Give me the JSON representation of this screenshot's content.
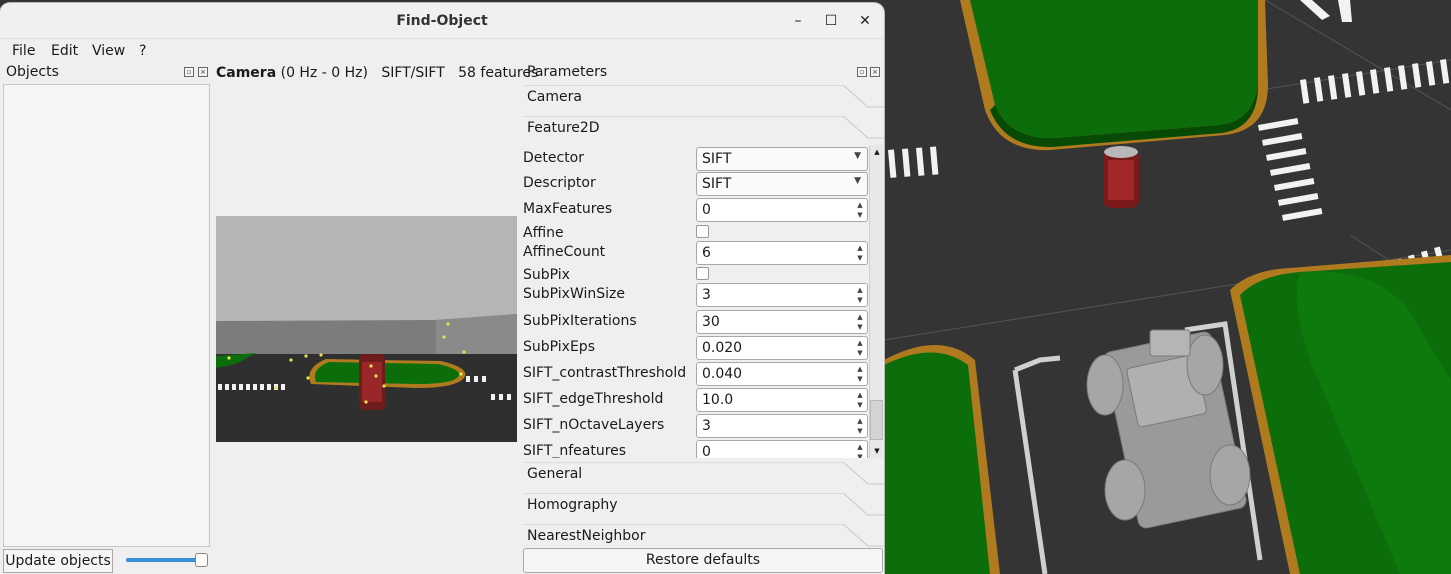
{
  "window": {
    "title": "Find-Object",
    "minimize_glyph": "–",
    "maximize_glyph": "☐",
    "close_glyph": "✕"
  },
  "menu": [
    "File",
    "Edit",
    "View",
    "?"
  ],
  "objects_dock": {
    "title": "Objects",
    "update_label": "Update objects",
    "slider_level": 1.0
  },
  "camera": {
    "name": "Camera",
    "rate": "(0 Hz - 0 Hz)",
    "algo": "SIFT/SIFT",
    "features": "58 features"
  },
  "parameters": {
    "title": "Parameters",
    "tabs_top": [
      "Camera",
      "Feature2D"
    ],
    "rows": [
      {
        "label": "Detector",
        "kind": "combo",
        "value": "SIFT"
      },
      {
        "label": "Descriptor",
        "kind": "combo",
        "value": "SIFT"
      },
      {
        "label": "MaxFeatures",
        "kind": "spin",
        "value": "0"
      },
      {
        "label": "Affine",
        "kind": "check",
        "value": ""
      },
      {
        "label": "AffineCount",
        "kind": "spin",
        "value": "6"
      },
      {
        "label": "SubPix",
        "kind": "check",
        "value": ""
      },
      {
        "label": "SubPixWinSize",
        "kind": "spin",
        "value": "3"
      },
      {
        "label": "SubPixIterations",
        "kind": "spin",
        "value": "30"
      },
      {
        "label": "SubPixEps",
        "kind": "spin",
        "value": "0.020"
      },
      {
        "label": "SIFT_contrastThreshold",
        "kind": "spin",
        "value": "0.040"
      },
      {
        "label": "SIFT_edgeThreshold",
        "kind": "spin",
        "value": "10.0"
      },
      {
        "label": "SIFT_nOctaveLayers",
        "kind": "spin",
        "value": "3"
      },
      {
        "label": "SIFT_nfeatures",
        "kind": "spin",
        "value": "0"
      }
    ],
    "tabs_bottom": [
      "General",
      "Homography",
      "NearestNeighbor"
    ],
    "restore_label": "Restore defaults"
  },
  "colors": {
    "asphalt": "#353535",
    "grass": "#0a6b0a",
    "curb": "#b07a1e",
    "window_bg": "#efefef"
  }
}
